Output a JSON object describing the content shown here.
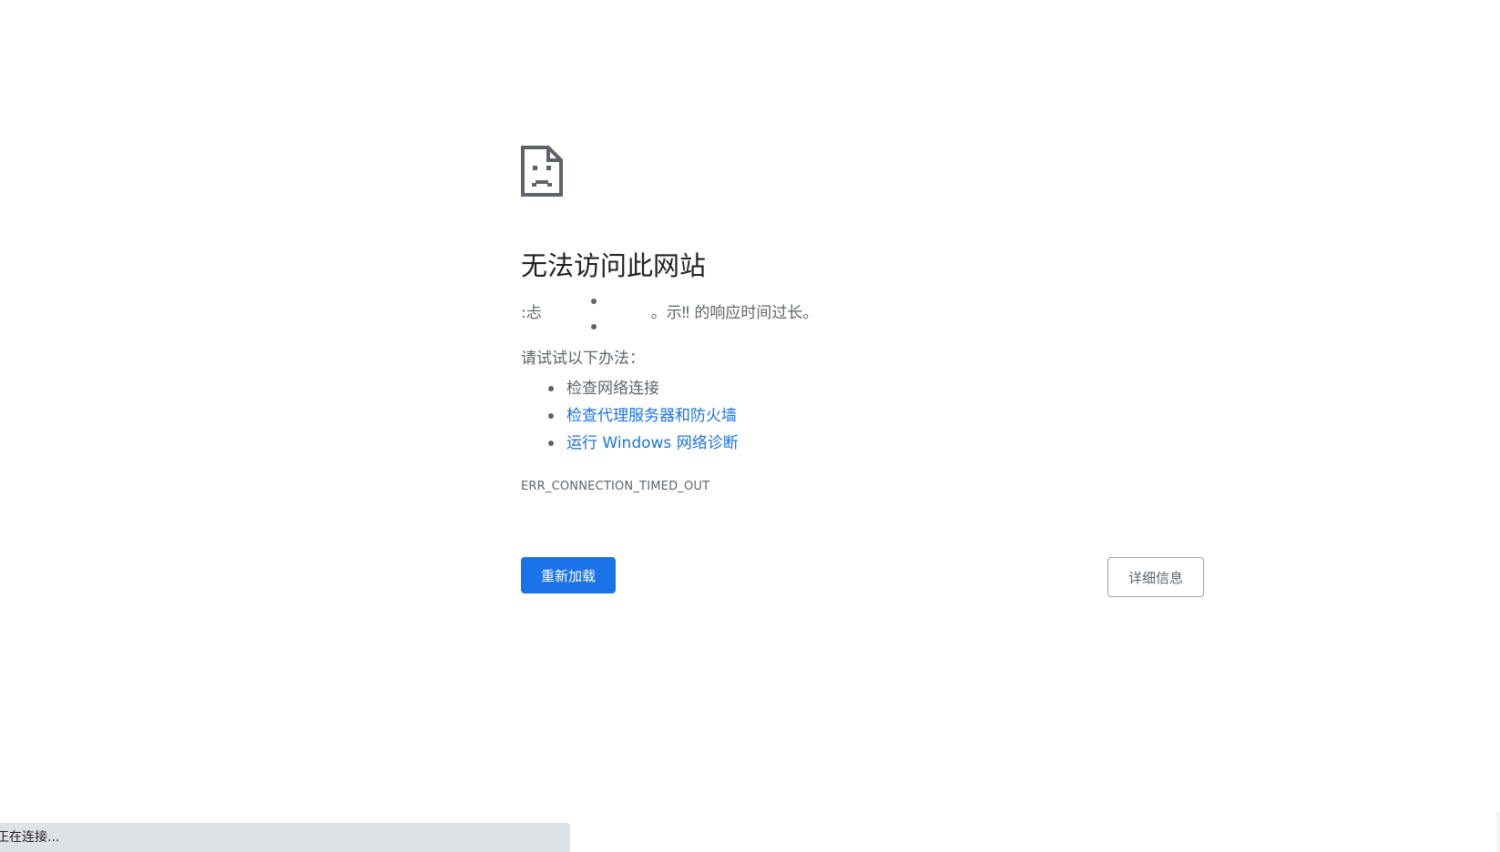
{
  "error_page": {
    "heading": "无法访问此网站",
    "summary_prefix": ":忐",
    "summary_mid": "。示‼",
    "summary_suffix": "的响应时间过长。",
    "try_label": "请试试以下办法：",
    "suggestions": [
      {
        "label": "检查网络连接",
        "is_link": false
      },
      {
        "label": "检查代理服务器和防火墙",
        "is_link": true
      },
      {
        "label": "运行 Windows 网络诊断",
        "is_link": true
      }
    ],
    "error_code": "ERR_CONNECTION_TIMED_OUT",
    "reload_label": "重新加载",
    "details_label": "详细信息"
  },
  "status_bar": {
    "text": "正在连接..."
  },
  "colors": {
    "link": "#1a73e8",
    "button_primary": "#1a73e8",
    "text_secondary": "#5f6368",
    "status_bar_bg": "#dee1e6"
  },
  "icons": {
    "error": "sad-page-icon"
  }
}
